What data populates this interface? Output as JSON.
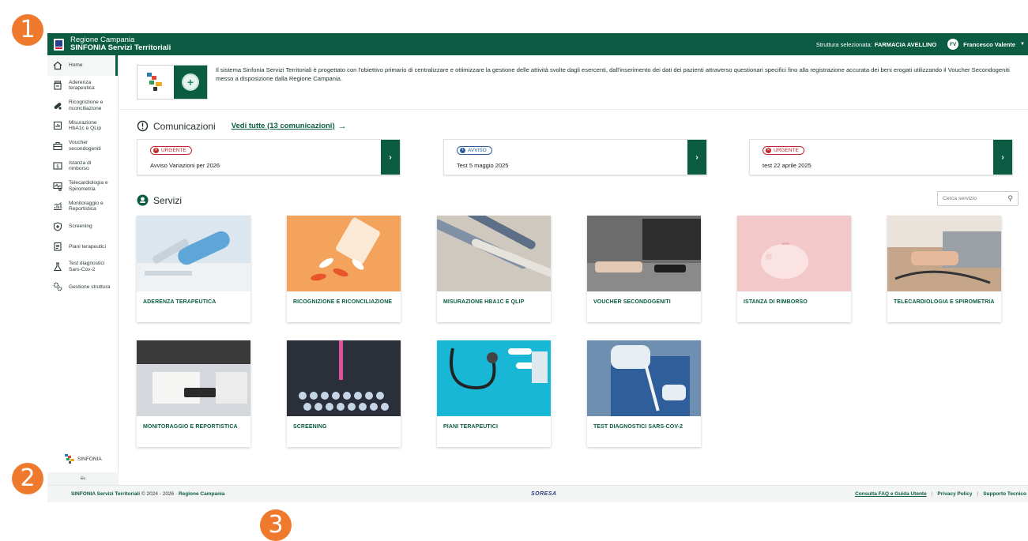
{
  "markers": [
    "1",
    "2",
    "3"
  ],
  "header": {
    "org": "Regione Campania",
    "app": "SINFONIA Servizi Territoriali",
    "struttura_label": "Struttura selezionata:",
    "struttura_value": "FARMACIA AVELLINO",
    "avatar": "FV",
    "user": "Francesco Valente"
  },
  "sidebar": {
    "items": [
      {
        "label": "Home",
        "icon": "home-icon"
      },
      {
        "label": "Aderenza terapeutica",
        "icon": "pill-bottle-icon"
      },
      {
        "label": "Ricognizione e riconciliazione",
        "icon": "pills-icon"
      },
      {
        "label": "Misurazione HbA1c e QLip",
        "icon": "meter-icon"
      },
      {
        "label": "Voucher secondogeniti",
        "icon": "voucher-icon"
      },
      {
        "label": "Istanza di rimborso",
        "icon": "money-icon"
      },
      {
        "label": "Telecardiologia e Spirometria",
        "icon": "heart-monitor-icon"
      },
      {
        "label": "Monitoraggio e Reportistica",
        "icon": "chart-icon"
      },
      {
        "label": "Screening",
        "icon": "shield-icon"
      },
      {
        "label": "Piani terapeutici",
        "icon": "clipboard-icon"
      },
      {
        "label": "Test diagnostici Sars-Cov-2",
        "icon": "flask-icon"
      },
      {
        "label": "Gestione struttura",
        "icon": "gears-icon"
      }
    ],
    "logo_text": "SINFONIA",
    "collapse": "≡‹"
  },
  "intro": {
    "text": "Il sistema Sinfonia Servizi Territoriali è progettato con l'obiettivo primario di centralizzare e ottimizzare la gestione delle attività svolte dagli esercenti, dall'inserimento dei dati dei pazienti attraverso questionari specifici fino alla registrazione accurata dei beni erogati utilizzando il Voucher Secondogeniti messo a disposizione dalla Regione Campania."
  },
  "comunicazioni": {
    "title": "Comunicazioni",
    "link": "Vedi tutte (13 comunicazioni)",
    "items": [
      {
        "tag": "URGENTE",
        "kind": "urgent",
        "text": "Avviso Variazioni per 2026"
      },
      {
        "tag": "AVVISO",
        "kind": "info",
        "text": "Test 5 maggio 2025"
      },
      {
        "tag": "URGENTE",
        "kind": "urgent",
        "text": "test 22 aprile 2025"
      }
    ]
  },
  "servizi": {
    "title": "Servizi",
    "search_placeholder": "Cerca servizio",
    "cards": [
      "ADERENZA TERAPEUTICA",
      "RICOGNIZIONE E RICONCILIAZIONE",
      "MISURAZIONE HBA1C E QLIP",
      "VOUCHER SECONDOGENITI",
      "ISTANZA DI RIMBORSO",
      "TELECARDIOLOGIA E SPIROMETRIA",
      "MONITORAGGIO E REPORTISTICA",
      "SCREENING",
      "PIANI TERAPEUTICI",
      "TEST DIAGNOSTICI SARS-COV-2"
    ]
  },
  "footer": {
    "app": "SINFONIA Servizi Territoriali",
    "copy": "© 2024 - 2026 ·",
    "region": "Regione Campania",
    "partner": "SORESA",
    "faq": "Consulta FAQ e Guida Utente",
    "privacy": "Privacy Policy",
    "support": "Supporto Tecnico"
  },
  "colors": {
    "primary": "#0b5c43",
    "urgent": "#c3272b",
    "info": "#2c5f9e",
    "marker": "#ef7a2e"
  }
}
